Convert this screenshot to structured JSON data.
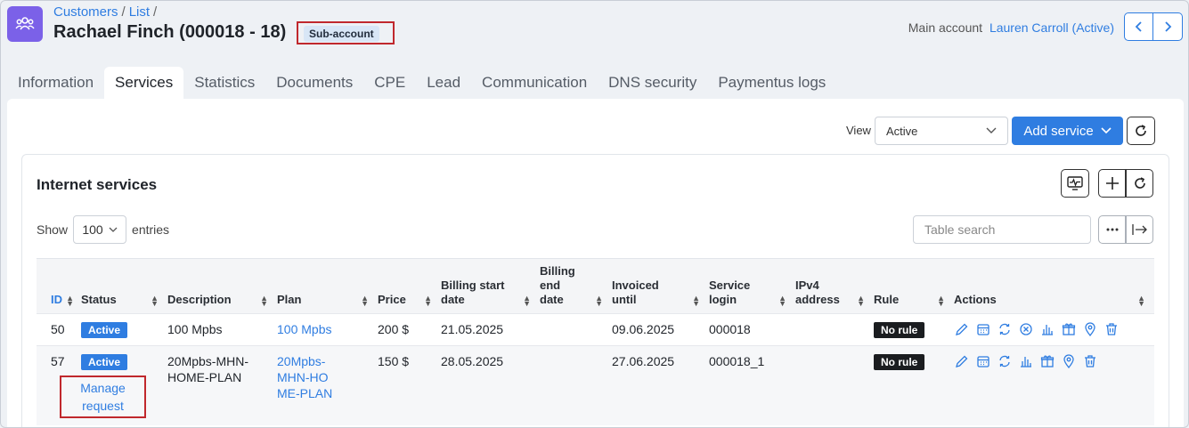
{
  "breadcrumb": {
    "customers": "Customers",
    "list": "List",
    "sep": "/"
  },
  "title": "Rachael Finch (000018 - 18)",
  "sub_account_badge": "Sub-account",
  "main_account": {
    "label": "Main account",
    "link": "Lauren Carroll (Active)"
  },
  "tabs": [
    {
      "label": "Information"
    },
    {
      "label": "Services"
    },
    {
      "label": "Statistics"
    },
    {
      "label": "Documents"
    },
    {
      "label": "CPE"
    },
    {
      "label": "Lead"
    },
    {
      "label": "Communication"
    },
    {
      "label": "DNS security"
    },
    {
      "label": "Paymentus logs"
    }
  ],
  "toolbar": {
    "view_label": "View",
    "view_value": "Active",
    "add_service": "Add service"
  },
  "card": {
    "title": "Internet services",
    "show_label": "Show",
    "entries_value": "100",
    "entries_label": "entries",
    "search_placeholder": "Table search"
  },
  "table": {
    "headers": {
      "id": "ID",
      "status": "Status",
      "description": "Description",
      "plan": "Plan",
      "price": "Price",
      "billing_start": "Billing start date",
      "billing_end": "Billing end date",
      "invoiced_until": "Invoiced until",
      "service_login": "Service login",
      "ipv4": "IPv4 address",
      "rule": "Rule",
      "actions": "Actions"
    },
    "rows": [
      {
        "id": "50",
        "status": "Active",
        "description": "100 Mpbs",
        "plan": "100 Mpbs",
        "price": "200 $",
        "billing_start": "21.05.2025",
        "billing_end": "",
        "invoiced_until": "09.06.2025",
        "service_login": "000018",
        "ipv4": "",
        "rule": "No rule"
      },
      {
        "id": "57",
        "status": "Active",
        "manage": "Manage request",
        "description": "20Mpbs-MHN-HOME-PLAN",
        "plan": "20Mpbs-MHN-HOME-PLAN",
        "price": "150 $",
        "billing_start": "28.05.2025",
        "billing_end": "",
        "invoiced_until": "27.06.2025",
        "service_login": "000018_1",
        "ipv4": "",
        "rule": "No rule"
      }
    ]
  },
  "colors": {
    "accent": "#2f7de1",
    "highlight_outline": "#c0282d",
    "app_icon": "#7b61e8"
  }
}
